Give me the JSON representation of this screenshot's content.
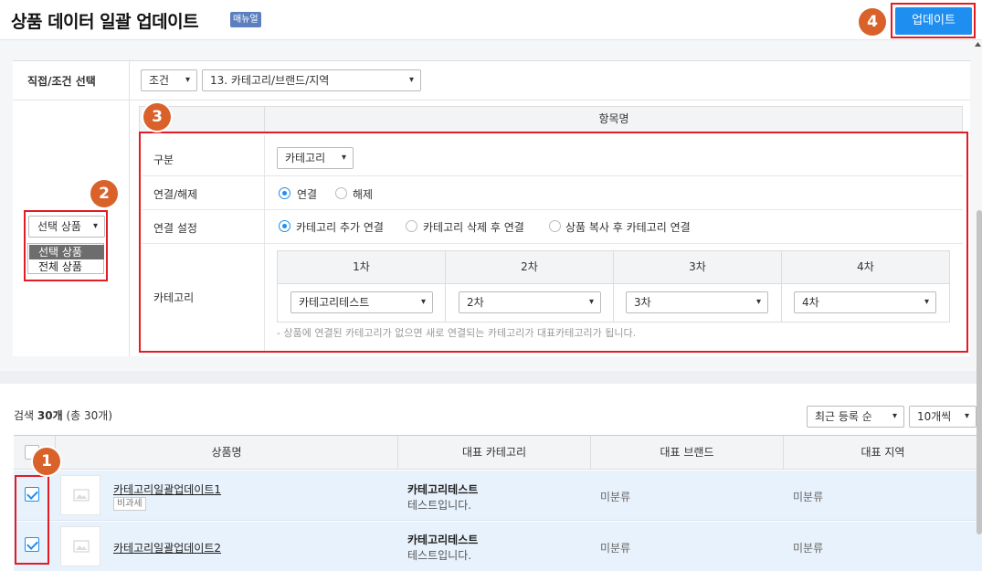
{
  "header": {
    "title": "상품 데이터 일괄 업데이트",
    "manual_badge": "매뉴얼",
    "update_button": "업데이트"
  },
  "filter": {
    "label": "직접/조건 선택",
    "condition_select": "조건",
    "condition_value": "13. 카테고리/브랜드/지역"
  },
  "items": {
    "header": "항목명",
    "rows": {
      "division": {
        "label": "구분",
        "select": "카테고리"
      },
      "link": {
        "label": "연결/해제",
        "options": [
          "연결",
          "해제"
        ],
        "selected": "연결"
      },
      "link_setting": {
        "label": "연결 설정",
        "options": [
          "카테고리 추가 연결",
          "카테고리 삭제 후 연결",
          "상품 복사 후 카테고리 연결"
        ],
        "selected": "카테고리 추가 연결"
      },
      "category": {
        "label": "카테고리",
        "columns": [
          "1차",
          "2차",
          "3차",
          "4차"
        ],
        "values": [
          "카테고리테스트",
          "2차",
          "3차",
          "4차"
        ],
        "note": "- 상품에 연결된 카테고리가 없으면 새로 연결되는 카테고리가 대표카테고리가 됩니다."
      }
    }
  },
  "target_select": {
    "value": "선택 상품",
    "options": [
      "선택 상품",
      "전체 상품"
    ]
  },
  "list": {
    "search_prefix": "검색",
    "search_count": "30개",
    "search_total": "(총 30개)",
    "sort": "최근 등록 순",
    "per_page": "10개씩",
    "columns": [
      "상품명",
      "대표 카테고리",
      "대표 브랜드",
      "대표 지역"
    ],
    "rows": [
      {
        "name": "카테고리일괄업데이트1",
        "badge": "비과세",
        "category": "카테고리테스트",
        "category_sub": "테스트입니다.",
        "brand": "미분류",
        "region": "미분류",
        "checked": true
      },
      {
        "name": "카테고리일괄업데이트2",
        "category": "카테고리테스트",
        "category_sub": "테스트입니다.",
        "brand": "미분류",
        "region": "미분류",
        "checked": true
      }
    ]
  },
  "annotations": [
    "1",
    "2",
    "3",
    "4"
  ],
  "colors": {
    "accent": "#1f8ef1",
    "highlight": "#e51b23",
    "badge": "#d9622b",
    "row_selected": "#e8f2fc"
  }
}
